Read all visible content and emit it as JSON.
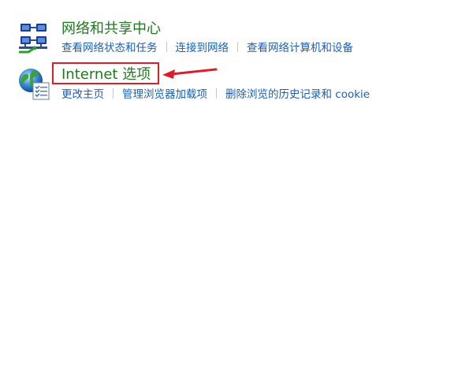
{
  "network_sharing": {
    "title": "网络和共享中心",
    "icon": "network-sharing-icon",
    "links": [
      {
        "label": "查看网络状态和任务"
      },
      {
        "label": "连接到网络"
      },
      {
        "label": "查看网络计算机和设备"
      }
    ]
  },
  "internet_options": {
    "title": "Internet 选项",
    "icon": "internet-options-icon",
    "links": [
      {
        "label": "更改主页"
      },
      {
        "label": "管理浏览器加载项"
      },
      {
        "label": "删除浏览的历史记录和 cookie"
      }
    ]
  },
  "colors": {
    "title_green": "#1e7a1e",
    "link_blue": "#1a5fb4",
    "annotation_red": "#d8202a"
  }
}
